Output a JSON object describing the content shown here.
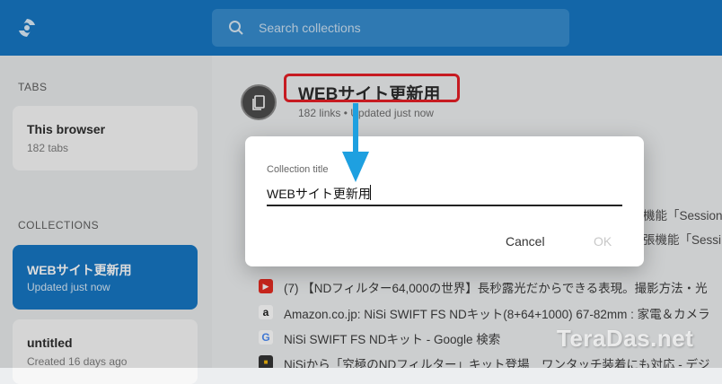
{
  "header": {
    "search_placeholder": "Search collections"
  },
  "sidebar": {
    "tabs_label": "TABS",
    "browser_card": {
      "title": "This browser",
      "subtitle": "182 tabs"
    },
    "collections_label": "COLLECTIONS",
    "collections": [
      {
        "title": "WEBサイト更新用",
        "subtitle": "Updated just now",
        "active": true
      },
      {
        "title": "untitled",
        "subtitle": "Created 16 days ago",
        "active": false
      }
    ]
  },
  "main": {
    "collection_title": "WEBサイト更新用",
    "collection_meta": "182 links  •  Updated just now",
    "partial_lines": [
      "機能「Session",
      "張機能「Sessi"
    ],
    "tab_rows": [
      {
        "icon": "youtube-icon",
        "text": "(7) 【NDフィルター64,000の世界】長秒露光だからできる表現。撮影方法・光"
      },
      {
        "icon": "amazon-icon",
        "text": "Amazon.co.jp: NiSi SWIFT FS NDキット(8+64+1000) 67-82mm : 家電＆カメラ"
      },
      {
        "icon": "google-icon",
        "text": "NiSi SWIFT FS NDキット - Google 検索"
      },
      {
        "icon": "site-icon",
        "text": "NiSiから「究極のNDフィルター」キット登場　ワンタッチ装着にも対応 - デジ"
      }
    ]
  },
  "dialog": {
    "label": "Collection title",
    "value": "WEBサイト更新用",
    "cancel_label": "Cancel",
    "ok_label": "OK"
  },
  "watermark": "TeraDas.net",
  "colors": {
    "accent": "#0a6fc0",
    "highlight_box": "#e5141b",
    "arrow": "#1ea0e0"
  }
}
